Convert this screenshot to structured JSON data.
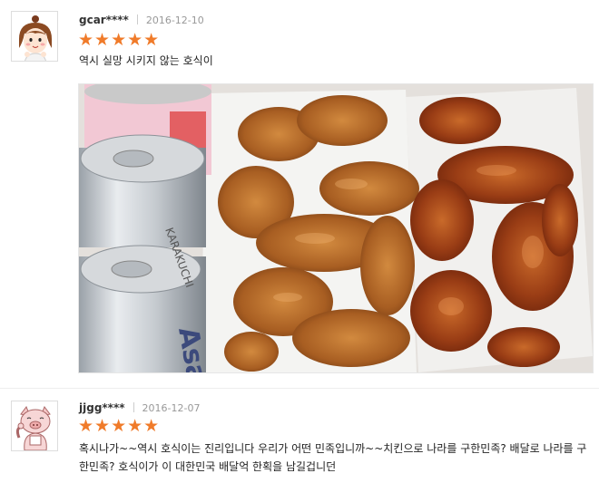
{
  "reviews": [
    {
      "username": "gcar****",
      "date": "2016-12-10",
      "stars": "★★★★★",
      "rating": 5,
      "text": "역시 실망 시키지 않는 호식이"
    },
    {
      "username": "jjgg****",
      "date": "2016-12-07",
      "stars": "★★★★★",
      "rating": 5,
      "text_line1": "혹시나가~~역시 호식이는 진리입니다 우리가 어떤 민족입니까~~치킨으로 나라를 구한민족? 배달로 나라를 구",
      "text_line2": "한민족? 호식이가 이 대한민국 배달억 한획을 남길겁니던"
    }
  ],
  "colors": {
    "star": "#f07b2a",
    "date": "#999999"
  },
  "icons": {
    "avatar1": "girl-character-icon",
    "avatar2": "pig-character-icon"
  }
}
